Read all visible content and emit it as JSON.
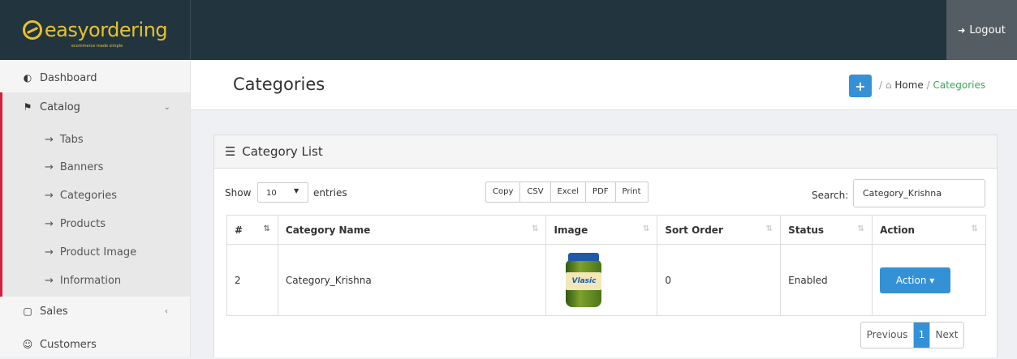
{
  "brand": {
    "name": "easyordering",
    "tagline": "ecommerce made simple"
  },
  "topbar": {
    "logout_label": "Logout",
    "logout_icon": "sign-out-icon"
  },
  "sidebar": {
    "items": [
      {
        "label": "Dashboard",
        "icon": "dashboard-icon"
      },
      {
        "label": "Catalog",
        "icon": "tag-icon",
        "caret": "⌄",
        "expanded": true
      },
      {
        "label": "Sales",
        "icon": "cart-icon",
        "caret": "‹"
      },
      {
        "label": "Customers",
        "icon": "user-icon"
      }
    ],
    "catalog_sub": [
      {
        "label": "Tabs"
      },
      {
        "label": "Banners"
      },
      {
        "label": "Categories"
      },
      {
        "label": "Products"
      },
      {
        "label": "Product Image"
      },
      {
        "label": "Information"
      }
    ],
    "arrow": "→"
  },
  "header": {
    "title": "Categories",
    "add_label": "+",
    "breadcrumb": {
      "sep": "/",
      "home_icon": "⌂",
      "home": "Home",
      "current": "Categories"
    }
  },
  "panel": {
    "title": "Category List",
    "show_label": "Show",
    "entries_value": "10",
    "entries_label": "entries",
    "export_buttons": [
      "Copy",
      "CSV",
      "Excel",
      "PDF",
      "Print"
    ],
    "search_label": "Search:",
    "search_value": "Category_Krishna"
  },
  "table": {
    "columns": [
      "#",
      "Category Name",
      "Image",
      "Sort Order",
      "Status",
      "Action"
    ],
    "rows": [
      {
        "id": "2",
        "name": "Category_Krishna",
        "image_brand": "Vlasic",
        "sort_order": "0",
        "status": "Enabled",
        "action": "Action ▾"
      }
    ]
  },
  "pagination": {
    "previous": "Previous",
    "current": "1",
    "next": "Next"
  },
  "colors": {
    "topbar": "#22353f",
    "brand": "#e8c22c",
    "primary": "#3591d6",
    "active_border": "#d0203b",
    "breadcrumb_current": "#3ba55c"
  }
}
